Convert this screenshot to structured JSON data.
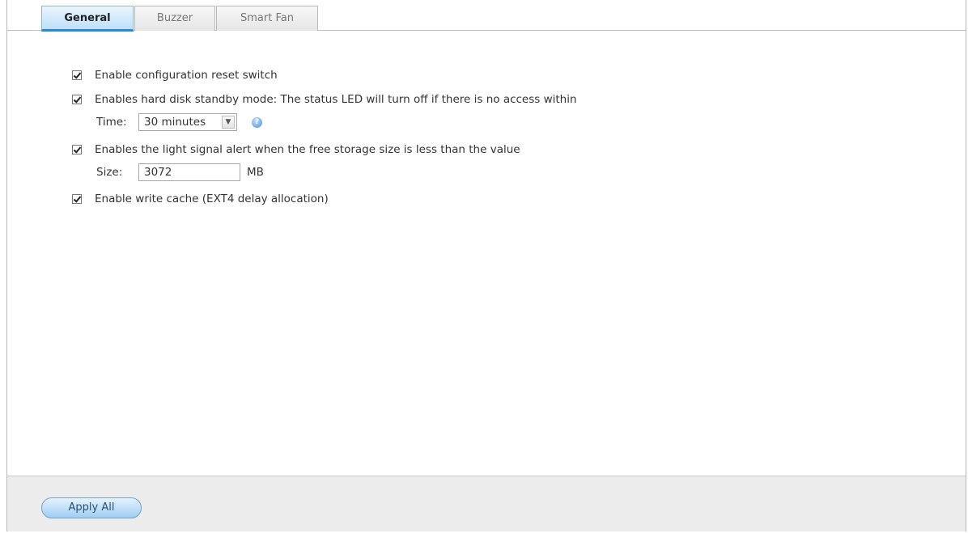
{
  "tabs": [
    {
      "label": "General",
      "active": true
    },
    {
      "label": "Buzzer",
      "active": false
    },
    {
      "label": "Smart Fan",
      "active": false
    }
  ],
  "general": {
    "reset_switch": {
      "label": "Enable configuration reset switch",
      "checked": true
    },
    "standby": {
      "label": "Enables hard disk standby mode: The status LED will turn off if there is no access within",
      "checked": true,
      "time_label": "Time:",
      "time_value": "30 minutes"
    },
    "light_alert": {
      "label": "Enables the light signal alert when the free storage size is less than the value",
      "checked": true,
      "size_label": "Size:",
      "size_value": "3072",
      "size_unit": "MB"
    },
    "write_cache": {
      "label": "Enable write cache (EXT4 delay allocation)",
      "checked": true
    }
  },
  "footer": {
    "apply_label": "Apply All"
  },
  "colors": {
    "accent": "#2a8ad8",
    "button_fill": "#9fcdf2"
  }
}
